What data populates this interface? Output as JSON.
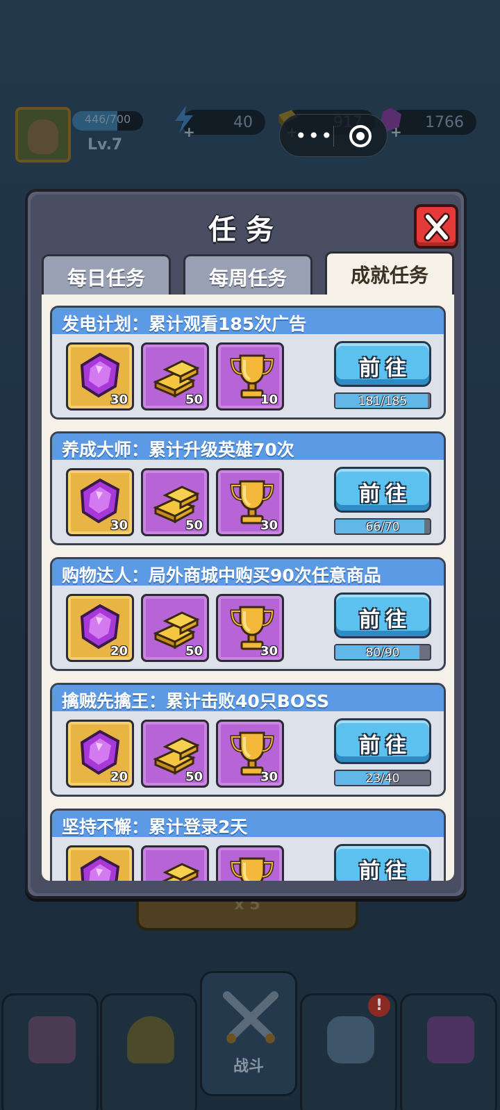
{
  "hud": {
    "xp_text": "446/700",
    "xp_fraction": 0.637,
    "level": "Lv.7",
    "energy": "40",
    "gold": "917",
    "gems": "1766"
  },
  "dialog": {
    "title": "任务",
    "tabs": [
      {
        "label": "每日任务",
        "active": false
      },
      {
        "label": "每周任务",
        "active": false
      },
      {
        "label": "成就任务",
        "active": true
      }
    ],
    "tasks": [
      {
        "title": "发电计划：累计观看185次广告",
        "rewards": [
          {
            "icon": "gem-icon",
            "qty": "30"
          },
          {
            "icon": "gold-bar-icon",
            "qty": "50"
          },
          {
            "icon": "trophy-icon",
            "qty": "10"
          }
        ],
        "button": "前往",
        "progress_text": "181/185",
        "progress": 0.978
      },
      {
        "title": "养成大师：累计升级英雄70次",
        "rewards": [
          {
            "icon": "gem-icon",
            "qty": "30"
          },
          {
            "icon": "gold-bar-icon",
            "qty": "50"
          },
          {
            "icon": "trophy-icon",
            "qty": "30"
          }
        ],
        "button": "前往",
        "progress_text": "66/70",
        "progress": 0.943
      },
      {
        "title": "购物达人：局外商城中购买90次任意商品",
        "rewards": [
          {
            "icon": "gem-icon",
            "qty": "20"
          },
          {
            "icon": "gold-bar-icon",
            "qty": "50"
          },
          {
            "icon": "trophy-icon",
            "qty": "30"
          }
        ],
        "button": "前往",
        "progress_text": "80/90",
        "progress": 0.889
      },
      {
        "title": "擒贼先擒王：累计击败40只BOSS",
        "rewards": [
          {
            "icon": "gem-icon",
            "qty": "20"
          },
          {
            "icon": "gold-bar-icon",
            "qty": "50"
          },
          {
            "icon": "trophy-icon",
            "qty": "30"
          }
        ],
        "button": "前往",
        "progress_text": "23/40",
        "progress": 0.575
      },
      {
        "title": "坚持不懈：累计登录2天",
        "rewards": [
          {
            "icon": "gem-icon",
            "qty": ""
          },
          {
            "icon": "gold-bar-icon",
            "qty": ""
          },
          {
            "icon": "trophy-icon",
            "qty": ""
          }
        ],
        "button": "前往",
        "progress_text": "",
        "progress": 0
      }
    ]
  },
  "background": {
    "bottom_button": "x 5"
  },
  "nav": {
    "items": [
      {
        "icon": "shop-icon",
        "label": ""
      },
      {
        "icon": "helmet-icon",
        "label": ""
      },
      {
        "icon": "crossed-swords-icon",
        "label": "战斗"
      },
      {
        "icon": "fist-icon",
        "label": ""
      },
      {
        "icon": "spellbook-icon",
        "label": ""
      }
    ],
    "badge": "!"
  },
  "colors": {
    "task_header": "#5d9ae6",
    "go_button": "#5cc1ee",
    "close_button": "#e43a3a",
    "gold_tile": "#e8b443",
    "purple_tile": "#b664d6"
  }
}
